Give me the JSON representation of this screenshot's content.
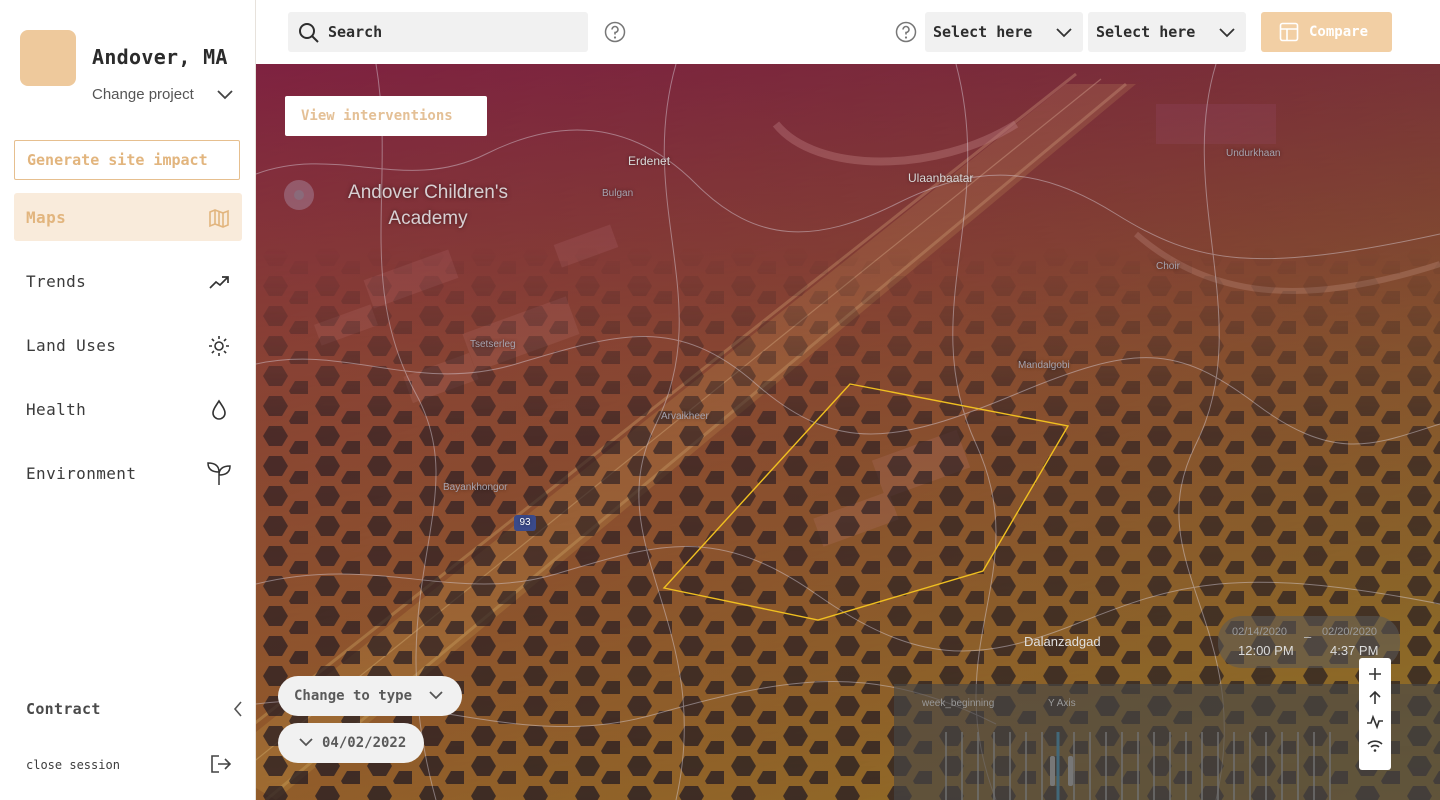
{
  "sidebar": {
    "project_name": "Andover, MA",
    "change_project_label": "Change project",
    "generate_button_label": "Generate site impact",
    "nav": [
      {
        "label": "Maps",
        "icon": "map-icon",
        "active": true
      },
      {
        "label": "Trends",
        "icon": "trend-up-icon",
        "active": false
      },
      {
        "label": "Land Uses",
        "icon": "sun-icon",
        "active": false
      },
      {
        "label": "Health",
        "icon": "droplet-icon",
        "active": false
      },
      {
        "label": "Environment",
        "icon": "sprout-icon",
        "active": false
      }
    ],
    "contract_label": "Contract",
    "close_session_label": "close session"
  },
  "topbar": {
    "search_placeholder": "Search",
    "select_1": "Select here",
    "select_2": "Select here",
    "compare_label": "Compare"
  },
  "map": {
    "view_interventions_label": "View interventions",
    "school_label": "Andover Children's Academy",
    "places": {
      "erdenet": "Erdenet",
      "ulaanbaatar": "Ulaanbaatar",
      "bulgan": "Bulgan",
      "undurkhaan": "Undurkhaan",
      "tsetserleg": "Tsetserleg",
      "mandalgobi": "Mandalgobi",
      "arvaikheer": "Arvaikheer",
      "bayankhongor": "Bayankhongor",
      "choir": "Choir",
      "dalanzadgad": "Dalanzadgad",
      "highway_shield": "93"
    },
    "time_range": {
      "start_date": "02/14/2020",
      "start_time": "12:00 PM",
      "end_date": "02/20/2020",
      "end_time": "4:37 PM",
      "separator": "–"
    },
    "chart_panel": {
      "x_label": "week_beginning",
      "y_label": "Y Axis"
    },
    "change_type_label": "Change to type",
    "date_label": "04/02/2022"
  },
  "colors": {
    "accent": "#e2b57e",
    "accent_light": "#f9ebdb",
    "compare_bg": "#f2cfa4",
    "overlay_red": "#8b1a45",
    "overlay_amber": "#b98a1f",
    "selection": "#f0c020"
  }
}
